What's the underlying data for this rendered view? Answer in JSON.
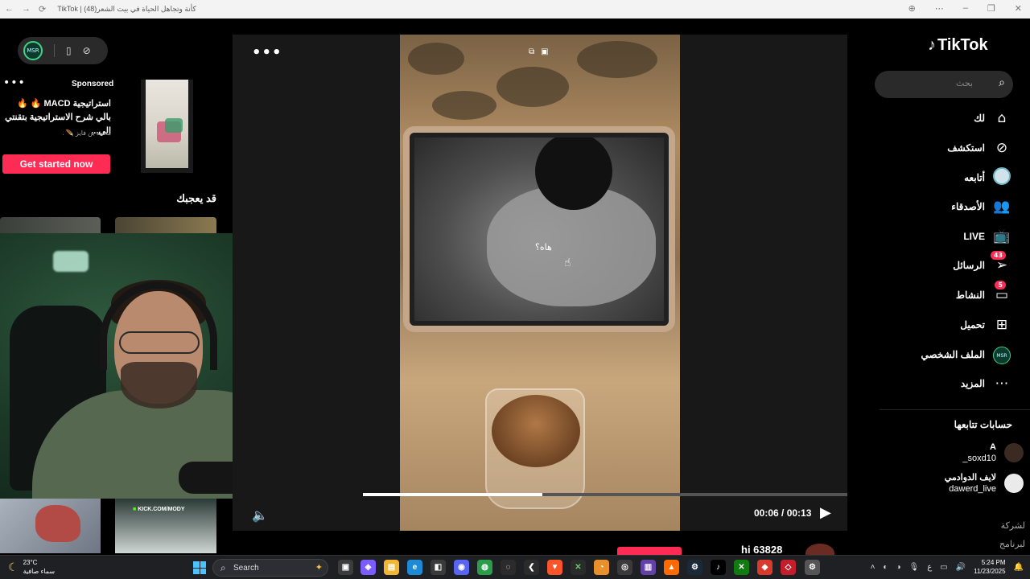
{
  "browser": {
    "title": "TikTok | كأنة وتجاهل الحياة في بيت الشعر(48)",
    "nav_back": "←",
    "nav_forward": "→",
    "nav_reload": "⟳"
  },
  "left": {
    "avatar_text": "MSR",
    "sponsored": "Sponsored",
    "ad_title": "استراتيجية MACD 🔥 🔥 بالي شرح الاستراتيجية بتقنتي الي...",
    "ad_author": "محمد بن فايز 🪶 .",
    "cta": "Get started now",
    "suggest_heading": "قد يعجبك",
    "kick_label_pre": "KICK.COM/",
    "kick_label_user": "MODY"
  },
  "player": {
    "caption": "هاه؟",
    "time": "00:06 / 00:13",
    "progress": 0.37,
    "more": "•••",
    "username_partial": "hi 63828"
  },
  "sidebar": {
    "logo": "TikTok",
    "search_placeholder": "بحث",
    "nav": [
      {
        "label": "لك",
        "icon": "home-icon"
      },
      {
        "label": "استكشف",
        "icon": "compass-icon"
      },
      {
        "label": "أتابعه",
        "icon": "avatar"
      },
      {
        "label": "الأصدقاء",
        "icon": "friends-icon"
      },
      {
        "label": "LIVE",
        "icon": "live-icon"
      },
      {
        "label": "الرسائل",
        "icon": "messages-icon",
        "badge": "43"
      },
      {
        "label": "النشاط",
        "icon": "activity-icon",
        "badge": "5"
      },
      {
        "label": "تحميل",
        "icon": "upload-icon"
      },
      {
        "label": "الملف الشخصي",
        "icon": "profile-avatar"
      },
      {
        "label": "المزيد",
        "icon": "more-icon"
      }
    ],
    "following_heading": "حسابات تتابعها",
    "following": [
      {
        "name": "A",
        "handle": "_soxd10"
      },
      {
        "name": "لايف الدوادمي",
        "handle": "dawerd_live"
      }
    ],
    "footer": [
      "لشركة",
      "لبرنامج"
    ]
  },
  "taskbar": {
    "temp": "23°C",
    "weather": "سماء صافية",
    "search": "Search",
    "time": "5:24 PM",
    "date": "11/23/2025",
    "lang": "ع"
  },
  "colors": {
    "accent": "#fe2c55",
    "background": "#000000",
    "player_bg": "#181818"
  }
}
